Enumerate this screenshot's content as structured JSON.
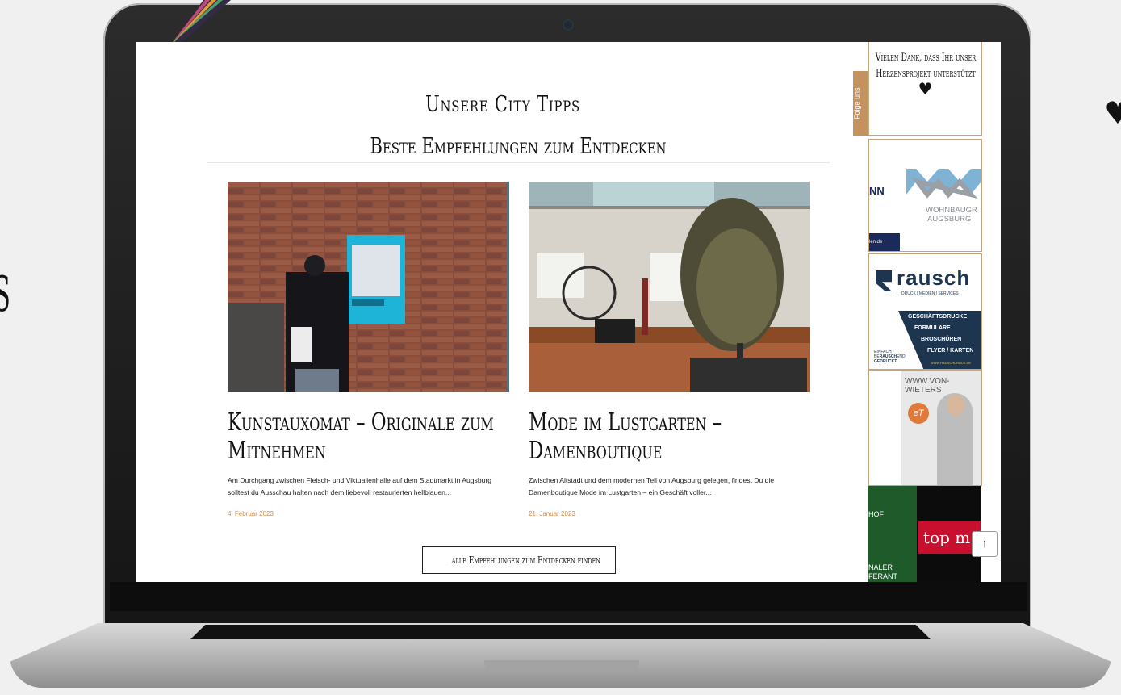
{
  "background": {
    "left_glyph": "S",
    "right_glyph": "♥"
  },
  "page": {
    "title": "Unsere City Tipps",
    "subtitle": "Beste Empfehlungen zum Entdecken",
    "all_button": "alle Empfehlungen zum Entdecken finden"
  },
  "posts": [
    {
      "title": "Kunstauxomat – Originale zum Mitnehmen",
      "excerpt": "Am Durchgang zwischen Fleisch- und Viktualienhalle auf dem Stadtmarkt in Augsburg solltest du Ausschau halten nach dem liebevoll restaurierten hellblauen...",
      "date": "4. Februar 2023",
      "image_label": "Kunstauxomat"
    },
    {
      "title": "Mode im Lustgarten – Damenboutique",
      "excerpt": "Zwischen Altstadt und dem modernen Teil von Augsburg gelegen, findest Du die Damenboutique Mode im Lustgarten – ein Geschäft voller...",
      "date": "21. Januar 2023"
    }
  ],
  "sidebar": {
    "thanks_text": "Vielen Dank, dass Ihr unser Herzensprojekt unterstützt",
    "heart": "♥",
    "follow_label": "Folge uns",
    "ads": {
      "wohnbau": {
        "left_text": "NN",
        "url_frag": "len.de",
        "line1": "WOHNBAUGR",
        "line2": "AUGSBURG"
      },
      "rausch": {
        "brand": "rausch",
        "tagline": "DRUCK | MEDIEN | SERVICES",
        "items": [
          "GESCHÄFTSDRUCKE",
          "FORMULARE",
          "BROSCHÜREN",
          "FLYER / KARTEN"
        ],
        "slogan_1": "EINFACH",
        "slogan_2a": "BE",
        "slogan_2b": "RAUSCH",
        "slogan_2c": "END",
        "slogan_3": "GEDRUCKT.",
        "url": "WWW.RAUSCHDRUCK.DE"
      },
      "wieters": {
        "url": "WWW.VON-WIETERS",
        "logo": "eT"
      },
      "topm": {
        "left_text_1": "HOF",
        "left_text_2": "NALER",
        "left_text_3": "FERANT",
        "brand": "top m"
      }
    }
  },
  "to_top": "↑",
  "colors": {
    "accent": "#d28a48",
    "border": "#c9a37e",
    "rausch_navy": "#1e3550",
    "topm_red": "#c8102e"
  }
}
